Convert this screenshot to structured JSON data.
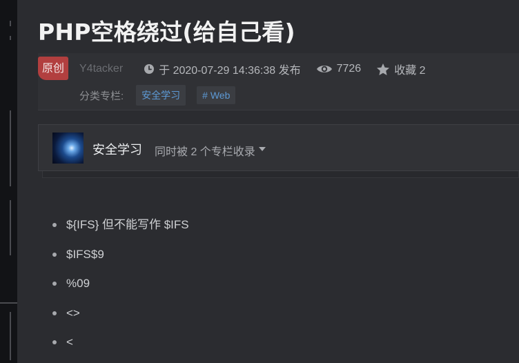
{
  "article": {
    "title": "PHP空格绕过(给自己看)",
    "badge": "原创",
    "author": "Y4tacker",
    "publish": "于 2020-07-29 14:36:38 发布",
    "views": "7726",
    "favorites": "收藏 2",
    "category_label": "分类专栏:",
    "tags": [
      "安全学习",
      "# Web"
    ]
  },
  "column": {
    "name": "安全学习",
    "subtitle": "同时被 2 个专栏收录"
  },
  "content": {
    "items": [
      "${IFS} 但不能写作 $IFS",
      "$IFS$9",
      "%09",
      "<>",
      "<"
    ]
  },
  "icons": {
    "clock": "clock-icon",
    "views": "eye-icon",
    "favorites": "star-icon",
    "dropdown": "caret-down-icon"
  },
  "colors": {
    "badge": "#b23f3f",
    "tag_text": "#5d9ad6",
    "background": "#2b2c30"
  }
}
